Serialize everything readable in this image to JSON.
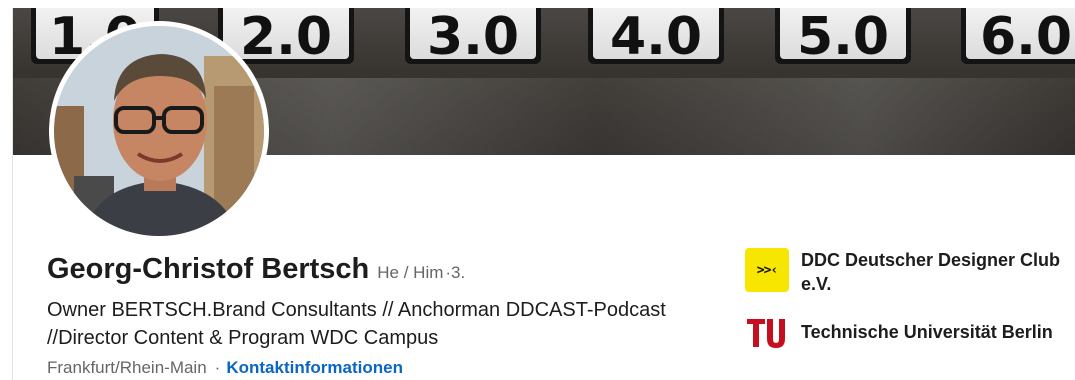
{
  "banner": {
    "tiles": [
      "1.0",
      "2.0",
      "3.0",
      "4.0",
      "5.0",
      "6.0"
    ]
  },
  "profile": {
    "name": "Georg-Christof Bertsch",
    "pronouns": "He / Him",
    "connection_degree": "·3.",
    "headline_line1": "Owner BERTSCH.Brand Consultants // Anchorman DDCAST-Podcast",
    "headline_line2": "//Director Content & Program WDC Campus",
    "location": "Frankfurt/Rhein-Main",
    "separator": "·",
    "contact_link": "Kontaktinformationen"
  },
  "organizations": [
    {
      "name_line1": "DDC Deutscher Designer Club",
      "name_line2": "e.V.",
      "logo_text": ">>‹",
      "logo_icon": "ddc-logo"
    },
    {
      "name_line1": "Technische Universität Berlin",
      "name_line2": "",
      "logo_icon": "tu-berlin-logo"
    }
  ],
  "colors": {
    "link": "#0a66c2",
    "ddc_yellow": "#f7e600",
    "tu_red": "#c50e1f",
    "text": "#1d1d1d",
    "muted": "#666666"
  }
}
